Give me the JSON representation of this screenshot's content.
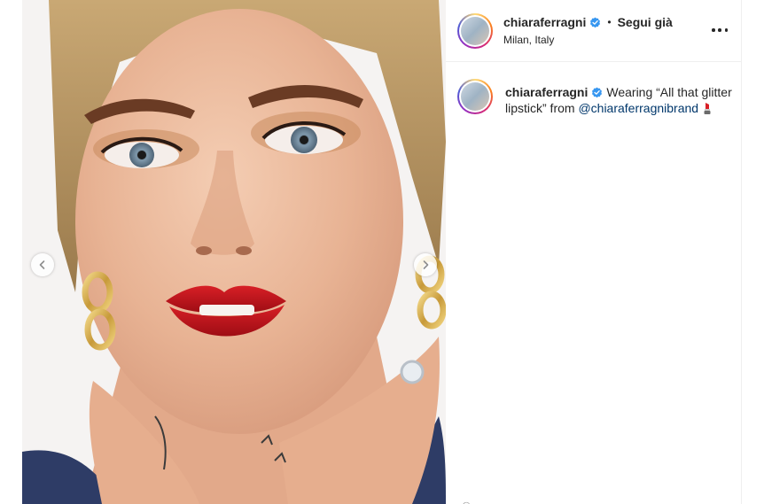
{
  "post": {
    "username": "chiaraferragni",
    "follow_status": "Segui già",
    "location": "Milan, Italy",
    "caption": {
      "username": "chiaraferragni",
      "text": "Wearing “All that glitter lipstick” from ",
      "mention": "@chiaraferragnibrand",
      "emoji_icon": "lipstick-emoji-icon"
    }
  },
  "icons": {
    "verified": "verified-badge-icon",
    "more": "more-options-icon",
    "prev": "chevron-left-icon",
    "next": "chevron-right-icon"
  },
  "colors": {
    "link": "#00376b",
    "verified": "#3897f0",
    "lips": "#c8161d"
  }
}
